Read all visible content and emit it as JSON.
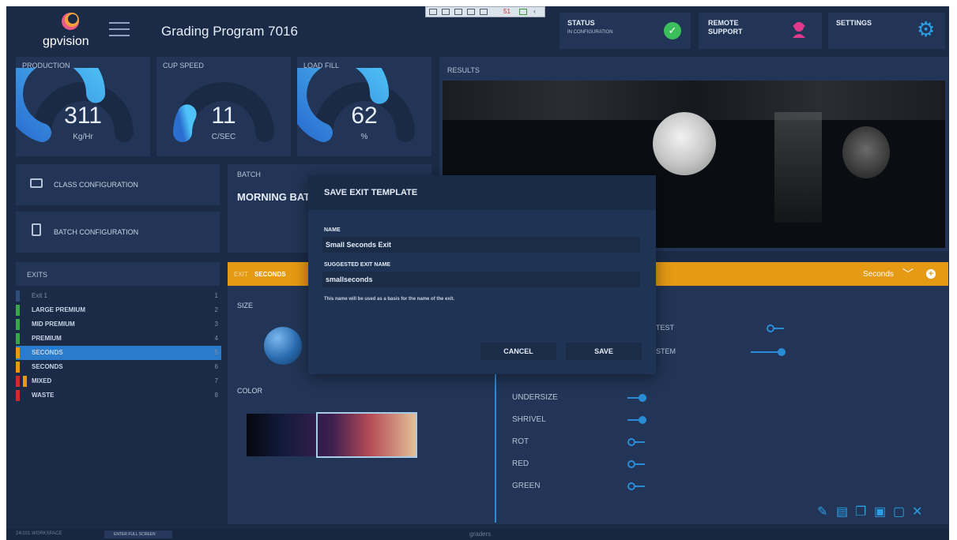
{
  "header": {
    "logo_text": "gpvision",
    "title": "Grading Program 7016",
    "status_label": "STATUS",
    "status_sub": "IN CONFIGURATION",
    "remote_label_1": "REMOTE",
    "remote_label_2": "SUPPORT",
    "settings_label": "SETTINGS",
    "toolbar_count": "51"
  },
  "gauges": [
    {
      "label": "PRODUCTION",
      "value": "311",
      "unit": "Kg/Hr",
      "fill": 0.6
    },
    {
      "label": "CUP SPEED",
      "value": "11",
      "unit": "C/SEC",
      "fill": 0.15
    },
    {
      "label": "LOAD FILL",
      "value": "62",
      "unit": "%",
      "fill": 0.62
    }
  ],
  "results": {
    "label": "RESULTS"
  },
  "config": {
    "class_label": "CLASS CONFIGURATION",
    "batch_label": "BATCH CONFIGURATION"
  },
  "batch": {
    "label": "BATCH",
    "value": "MORNING BAT"
  },
  "exits": {
    "title": "EXITS",
    "items": [
      {
        "name": "Exit 1",
        "num": "1",
        "color": "#2f4d7a"
      },
      {
        "name": "LARGE PREMIUM",
        "num": "2",
        "color": "#3aa64a"
      },
      {
        "name": "MID PREMIUM",
        "num": "3",
        "color": "#3aa64a"
      },
      {
        "name": "PREMIUM",
        "num": "4",
        "color": "#3aa64a"
      },
      {
        "name": "SECONDS",
        "num": "5",
        "color": "#e59a14"
      },
      {
        "name": "SECONDS",
        "num": "6",
        "color": "#e59a14"
      },
      {
        "name": "MIXED",
        "num": "7",
        "color": "#d12a2a"
      },
      {
        "name": "WASTE",
        "num": "8",
        "color": "#d12a2a"
      }
    ]
  },
  "exit_editor": {
    "header_prefix": "EXIT",
    "header_name": "SECONDS",
    "dropdown_value": "Seconds",
    "size_label": "SIZE",
    "color_label": "COLOR",
    "partial_1": "TEST",
    "partial_2": "STEM",
    "toggles": [
      {
        "name": "UNDERSIZE",
        "on": true
      },
      {
        "name": "SHRIVEL",
        "on": true
      },
      {
        "name": "ROT",
        "on": false
      },
      {
        "name": "RED",
        "on": false
      },
      {
        "name": "GREEN",
        "on": false
      }
    ]
  },
  "dialog": {
    "title": "SAVE EXIT TEMPLATE",
    "name_label": "NAME",
    "name_value": "Small Seconds Exit",
    "suggested_label": "SUGGESTED EXIT NAME",
    "suggested_value": "smallseconds",
    "hint": "This name will be used as a basis for the name of the exit.",
    "cancel": "CANCEL",
    "save": "SAVE"
  },
  "footer": {
    "workspace": "24/101 WORKSPACE",
    "fullscreen": "ENTER FULL SCREEN",
    "center": "graders"
  },
  "colors": {
    "accent": "#e59a14",
    "primary": "#2a8bd6",
    "status_ok": "#3bbf5a",
    "remote": "#e0398c"
  }
}
